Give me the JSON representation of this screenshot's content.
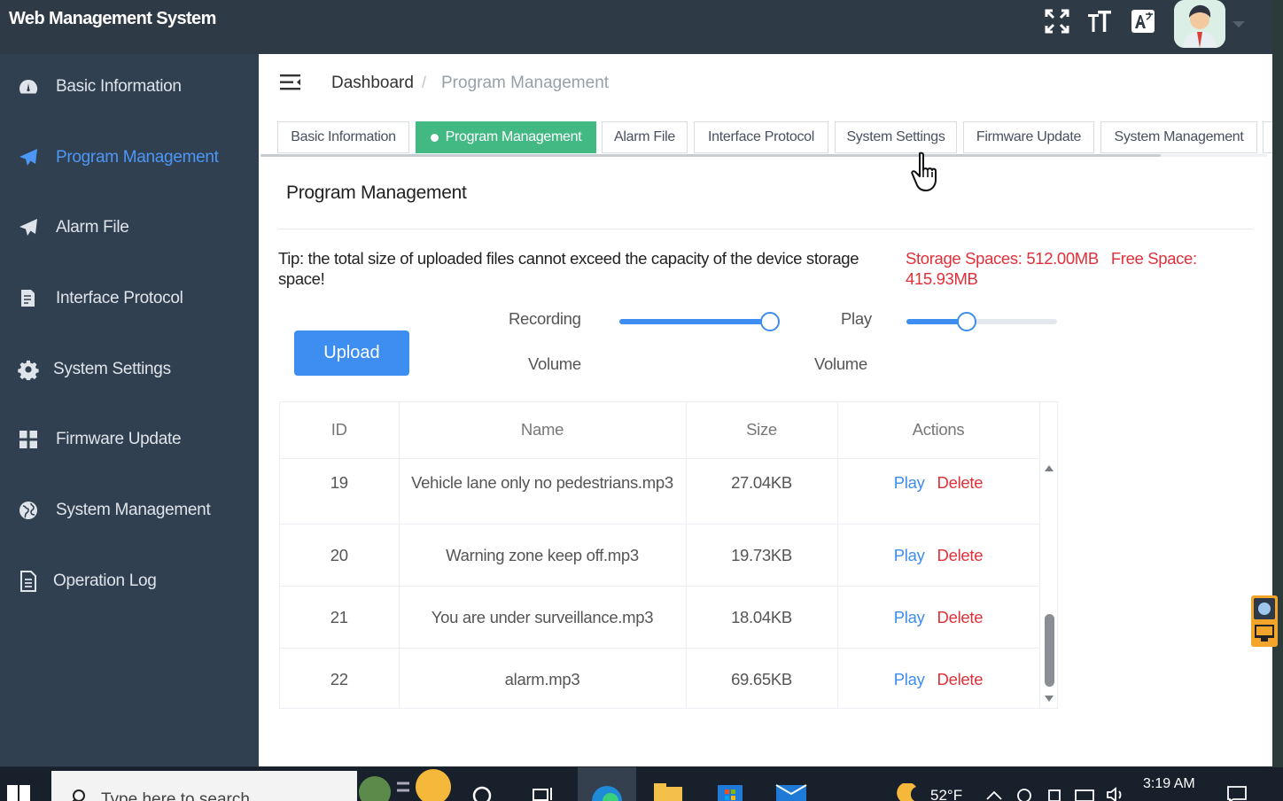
{
  "app": {
    "title": "Web Management System"
  },
  "header": {
    "icons": [
      "fullscreen-icon",
      "font-size-icon",
      "translate-icon"
    ]
  },
  "sidebar": {
    "items": [
      {
        "label": "Basic Information",
        "icon": "dashboard-icon",
        "active": false
      },
      {
        "label": "Program Management",
        "icon": "send-icon",
        "active": true
      },
      {
        "label": "Alarm File",
        "icon": "send-icon",
        "active": false
      },
      {
        "label": "Interface Protocol",
        "icon": "document-edit-icon",
        "active": false
      },
      {
        "label": "System Settings",
        "icon": "gear-icon",
        "active": false
      },
      {
        "label": "Firmware Update",
        "icon": "grid-icon",
        "active": false
      },
      {
        "label": "System Management",
        "icon": "globe-icon",
        "active": false
      },
      {
        "label": "Operation Log",
        "icon": "document-icon",
        "active": false
      }
    ]
  },
  "breadcrumb": {
    "home": "Dashboard",
    "separator": "/",
    "current": "Program Management"
  },
  "tabs": [
    {
      "label": "Basic Information",
      "active": false
    },
    {
      "label": "Program Management",
      "active": true
    },
    {
      "label": "Alarm File",
      "active": false
    },
    {
      "label": "Interface Protocol",
      "active": false
    },
    {
      "label": "System Settings",
      "active": false
    },
    {
      "label": "Firmware Update",
      "active": false
    },
    {
      "label": "System Management",
      "active": false
    }
  ],
  "page": {
    "title": "Program Management",
    "tip": "Tip: the total size of uploaded files cannot exceed the capacity of the device storage space!",
    "storage_label": "Storage Spaces: 512.00MB",
    "free_label": "Free Space: 415.93MB",
    "upload_label": "Upload",
    "recording_label_1": "Recording",
    "recording_label_2": "Volume",
    "play_label_1": "Play",
    "play_label_2": "Volume",
    "recording_volume": 1.0,
    "play_volume": 0.4
  },
  "table": {
    "columns": [
      "ID",
      "Name",
      "Size",
      "Actions"
    ],
    "rows": [
      {
        "id": "19",
        "name": "Vehicle lane only no pedestrians.mp3",
        "size": "27.04KB",
        "play": "Play",
        "delete": "Delete"
      },
      {
        "id": "20",
        "name": "Warning zone keep off.mp3",
        "size": "19.73KB",
        "play": "Play",
        "delete": "Delete"
      },
      {
        "id": "21",
        "name": "You are under surveillance.mp3",
        "size": "18.04KB",
        "play": "Play",
        "delete": "Delete"
      },
      {
        "id": "22",
        "name": "alarm.mp3",
        "size": "69.65KB",
        "play": "Play",
        "delete": "Delete"
      }
    ]
  },
  "taskbar": {
    "search_placeholder": "Type here to search",
    "temperature": "52°F",
    "time": "3:19 AM"
  },
  "colors": {
    "accent": "#3d8ef0",
    "active_tab": "#42b983",
    "danger": "#e0303a",
    "sidebar": "#304050"
  }
}
